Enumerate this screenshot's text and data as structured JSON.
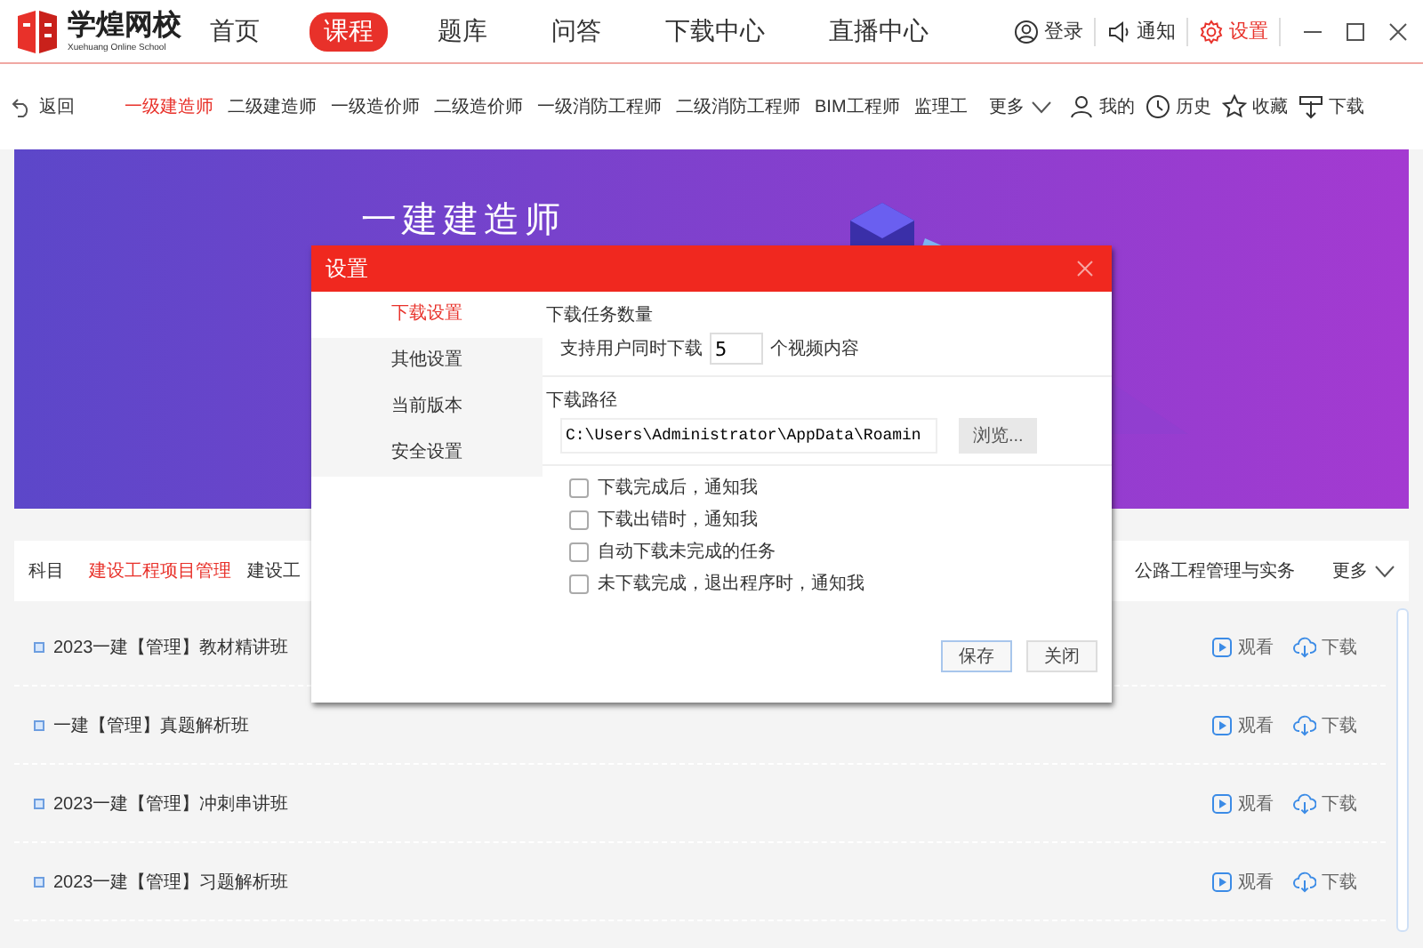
{
  "app": {
    "logo_text": "学煌网校",
    "logo_subtext": "Xuehuang Online School"
  },
  "main_nav": [
    {
      "label": "首页",
      "selected": false
    },
    {
      "label": "课程",
      "selected": true
    },
    {
      "label": "题库",
      "selected": false
    },
    {
      "label": "问答",
      "selected": false
    },
    {
      "label": "下载中心",
      "selected": false
    },
    {
      "label": "直播中心",
      "selected": false
    }
  ],
  "top_actions": [
    {
      "kind": "user",
      "label": "登录",
      "active": false
    },
    {
      "kind": "sound",
      "label": "通知",
      "active": false
    },
    {
      "kind": "gear",
      "label": "设置",
      "active": true
    }
  ],
  "back": "返回",
  "category_tabs": [
    {
      "label": "一级建造师",
      "selected": true
    },
    {
      "label": "二级建造师",
      "selected": false
    },
    {
      "label": "一级造价师",
      "selected": false
    },
    {
      "label": "二级造价师",
      "selected": false
    },
    {
      "label": "一级消防工程师",
      "selected": false
    },
    {
      "label": "二级消防工程师",
      "selected": false
    },
    {
      "label": "BIM工程师",
      "selected": false
    },
    {
      "label": "监理工",
      "selected": false
    }
  ],
  "category_more": "更多",
  "user_links": [
    {
      "kind": "person",
      "label": "我的"
    },
    {
      "kind": "clock",
      "label": "历史"
    },
    {
      "kind": "star",
      "label": "收藏"
    },
    {
      "kind": "download",
      "label": "下载"
    }
  ],
  "banner": {
    "title": "一建建造师"
  },
  "subject_bar": {
    "label": "科目",
    "items": [
      {
        "label": "建设工程项目管理",
        "selected": true
      },
      {
        "label": "建设工",
        "selected": false
      }
    ],
    "right_item": "公路工程管理与实务",
    "more": "更多"
  },
  "courses": [
    {
      "title": "2023一建【管理】教材精讲班",
      "watch": "观看",
      "download": "下载"
    },
    {
      "title": "一建【管理】真题解析班",
      "watch": "观看",
      "download": "下载"
    },
    {
      "title": "2023一建【管理】冲刺串讲班",
      "watch": "观看",
      "download": "下载"
    },
    {
      "title": "2023一建【管理】习题解析班",
      "watch": "观看",
      "download": "下载"
    }
  ],
  "dialog": {
    "title": "设置",
    "sidebar": [
      {
        "label": "下载设置",
        "selected": true
      },
      {
        "label": "其他设置",
        "selected": false
      },
      {
        "label": "当前版本",
        "selected": false
      },
      {
        "label": "安全设置",
        "selected": false
      }
    ],
    "task_section": {
      "heading": "下载任务数量",
      "prefix": "支持用户同时下载",
      "value": "5",
      "suffix": "个视频内容"
    },
    "path_section": {
      "heading": "下载路径",
      "value": "C:\\Users\\Administrator\\AppData\\Roamin",
      "browse": "浏览..."
    },
    "options": [
      {
        "label": "下载完成后，通知我",
        "checked": false
      },
      {
        "label": "下载出错时，通知我",
        "checked": false
      },
      {
        "label": "自动下载未完成的任务",
        "checked": false
      },
      {
        "label": "未下载完成，退出程序时，通知我",
        "checked": false
      }
    ],
    "buttons": [
      {
        "label": "保存",
        "primary": true
      },
      {
        "label": "关闭",
        "primary": false
      }
    ]
  }
}
